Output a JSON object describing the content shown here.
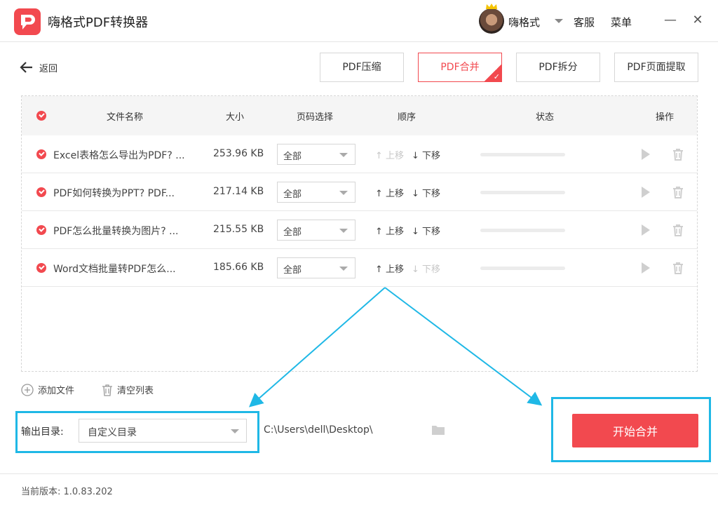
{
  "app": {
    "title": "嗨格式PDF转换器",
    "user_name": "嗨格式",
    "service_label": "客服",
    "menu_label": "菜单",
    "minimize_label": "—",
    "close_label": "✕"
  },
  "nav": {
    "back_label": "返回"
  },
  "tabs": [
    {
      "label": "PDF压缩",
      "active": false
    },
    {
      "label": "PDF合并",
      "active": true
    },
    {
      "label": "PDF拆分",
      "active": false
    },
    {
      "label": "PDF页面提取",
      "active": false
    }
  ],
  "table": {
    "headers": {
      "name": "文件名称",
      "size": "大小",
      "pages": "页码选择",
      "order": "顺序",
      "status": "状态",
      "actions": "操作"
    },
    "rows": [
      {
        "name": "Excel表格怎么导出为PDF? ...",
        "size": "253.96 KB",
        "pages": "全部",
        "up": "上移",
        "down": "下移",
        "up_enabled": false,
        "down_enabled": true
      },
      {
        "name": "PDF如何转换为PPT? PDF...",
        "size": "217.14 KB",
        "pages": "全部",
        "up": "上移",
        "down": "下移",
        "up_enabled": true,
        "down_enabled": true
      },
      {
        "name": "PDF怎么批量转换为图片? ...",
        "size": "215.55 KB",
        "pages": "全部",
        "up": "上移",
        "down": "下移",
        "up_enabled": true,
        "down_enabled": true
      },
      {
        "name": "Word文档批量转PDF怎么...",
        "size": "185.66 KB",
        "pages": "全部",
        "up": "上移",
        "down": "下移",
        "up_enabled": true,
        "down_enabled": false
      }
    ]
  },
  "toolbar": {
    "add_file": "添加文件",
    "clear_list": "清空列表"
  },
  "output": {
    "label": "输出目录:",
    "mode": "自定义目录",
    "path": "C:\\Users\\dell\\Desktop\\"
  },
  "start_button": "开始合并",
  "footer": {
    "version": "当前版本: 1.0.83.202"
  },
  "colors": {
    "accent": "#f2494f",
    "highlight": "#1fb8e6"
  }
}
